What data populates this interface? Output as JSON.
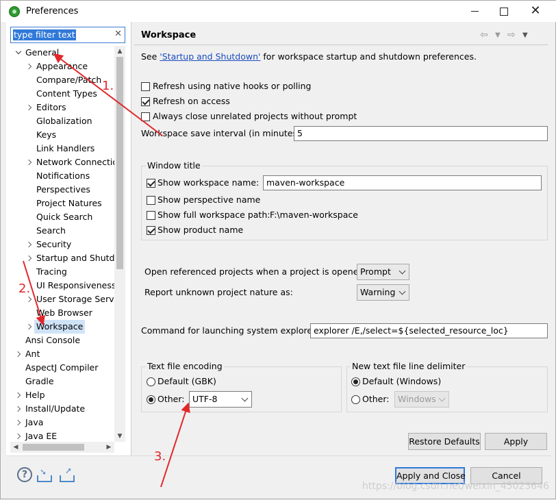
{
  "window": {
    "title": "Preferences"
  },
  "filter": {
    "value": "type filter text"
  },
  "tree": {
    "items": [
      {
        "label": "General",
        "indent": 0,
        "state": "expanded"
      },
      {
        "label": "Appearance",
        "indent": 1,
        "state": "collapsed"
      },
      {
        "label": "Compare/Patch",
        "indent": 1,
        "state": "leaf"
      },
      {
        "label": "Content Types",
        "indent": 1,
        "state": "leaf"
      },
      {
        "label": "Editors",
        "indent": 1,
        "state": "collapsed"
      },
      {
        "label": "Globalization",
        "indent": 1,
        "state": "leaf"
      },
      {
        "label": "Keys",
        "indent": 1,
        "state": "leaf"
      },
      {
        "label": "Link Handlers",
        "indent": 1,
        "state": "leaf"
      },
      {
        "label": "Network Connectio",
        "indent": 1,
        "state": "collapsed"
      },
      {
        "label": "Notifications",
        "indent": 1,
        "state": "leaf"
      },
      {
        "label": "Perspectives",
        "indent": 1,
        "state": "leaf"
      },
      {
        "label": "Project Natures",
        "indent": 1,
        "state": "leaf"
      },
      {
        "label": "Quick Search",
        "indent": 1,
        "state": "leaf"
      },
      {
        "label": "Search",
        "indent": 1,
        "state": "leaf"
      },
      {
        "label": "Security",
        "indent": 1,
        "state": "collapsed"
      },
      {
        "label": "Startup and Shutdo",
        "indent": 1,
        "state": "collapsed"
      },
      {
        "label": "Tracing",
        "indent": 1,
        "state": "leaf"
      },
      {
        "label": "UI Responsiveness",
        "indent": 1,
        "state": "leaf"
      },
      {
        "label": "User Storage Servic",
        "indent": 1,
        "state": "collapsed"
      },
      {
        "label": "Web Browser",
        "indent": 1,
        "state": "leaf"
      },
      {
        "label": "Workspace",
        "indent": 1,
        "state": "collapsed",
        "selected": true
      },
      {
        "label": "Ansi Console",
        "indent": 0,
        "state": "leaf"
      },
      {
        "label": "Ant",
        "indent": 0,
        "state": "collapsed"
      },
      {
        "label": "AspectJ Compiler",
        "indent": 0,
        "state": "leaf"
      },
      {
        "label": "Gradle",
        "indent": 0,
        "state": "leaf"
      },
      {
        "label": "Help",
        "indent": 0,
        "state": "collapsed"
      },
      {
        "label": "Install/Update",
        "indent": 0,
        "state": "collapsed"
      },
      {
        "label": "Java",
        "indent": 0,
        "state": "collapsed"
      },
      {
        "label": "Java EE",
        "indent": 0,
        "state": "collapsed"
      }
    ]
  },
  "page": {
    "title": "Workspace",
    "see_prefix": "See ",
    "see_link": "'Startup and Shutdown'",
    "see_suffix": " for workspace startup and shutdown preferences.",
    "refresh_native": {
      "label": "Refresh using native hooks or polling",
      "checked": false
    },
    "refresh_access": {
      "label": "Refresh on access",
      "checked": true
    },
    "always_close": {
      "label": "Always close unrelated projects without prompt",
      "checked": false
    },
    "save_interval_label": "Workspace save interval (in minutes):",
    "save_interval_value": "5",
    "window_title_group": "Window title",
    "show_ws_name": {
      "label": "Show workspace name:",
      "checked": true,
      "value": "maven-workspace"
    },
    "show_perspective": {
      "label": "Show perspective name",
      "checked": false
    },
    "show_full_path": {
      "label": "Show full workspace path:",
      "checked": false,
      "value": "F:\\maven-workspace"
    },
    "show_product": {
      "label": "Show product name",
      "checked": true
    },
    "open_ref_label": "Open referenced projects when a project is opened:",
    "open_ref_value": "Prompt",
    "report_nature_label": "Report unknown project nature as:",
    "report_nature_value": "Warning",
    "explorer_label": "Command for launching system explorer:",
    "explorer_value": "explorer /E,/select=${selected_resource_loc}",
    "encoding_group": "Text file encoding",
    "encoding_default": "Default (GBK)",
    "encoding_other": "Other:",
    "encoding_value": "UTF-8",
    "delimiter_group": "New text file line delimiter",
    "delimiter_default": "Default (Windows)",
    "delimiter_other": "Other:",
    "delimiter_value": "Windows",
    "restore_defaults": "Restore Defaults",
    "apply": "Apply"
  },
  "footer": {
    "apply_close": "Apply and Close",
    "cancel": "Cancel",
    "help_glyph": "?"
  },
  "watermark": "https://blog.csdn.net/weixin_45023646",
  "annotations": {
    "step1": "1.",
    "step2": "2.",
    "step3": "3.",
    "color": "#e3262a"
  }
}
